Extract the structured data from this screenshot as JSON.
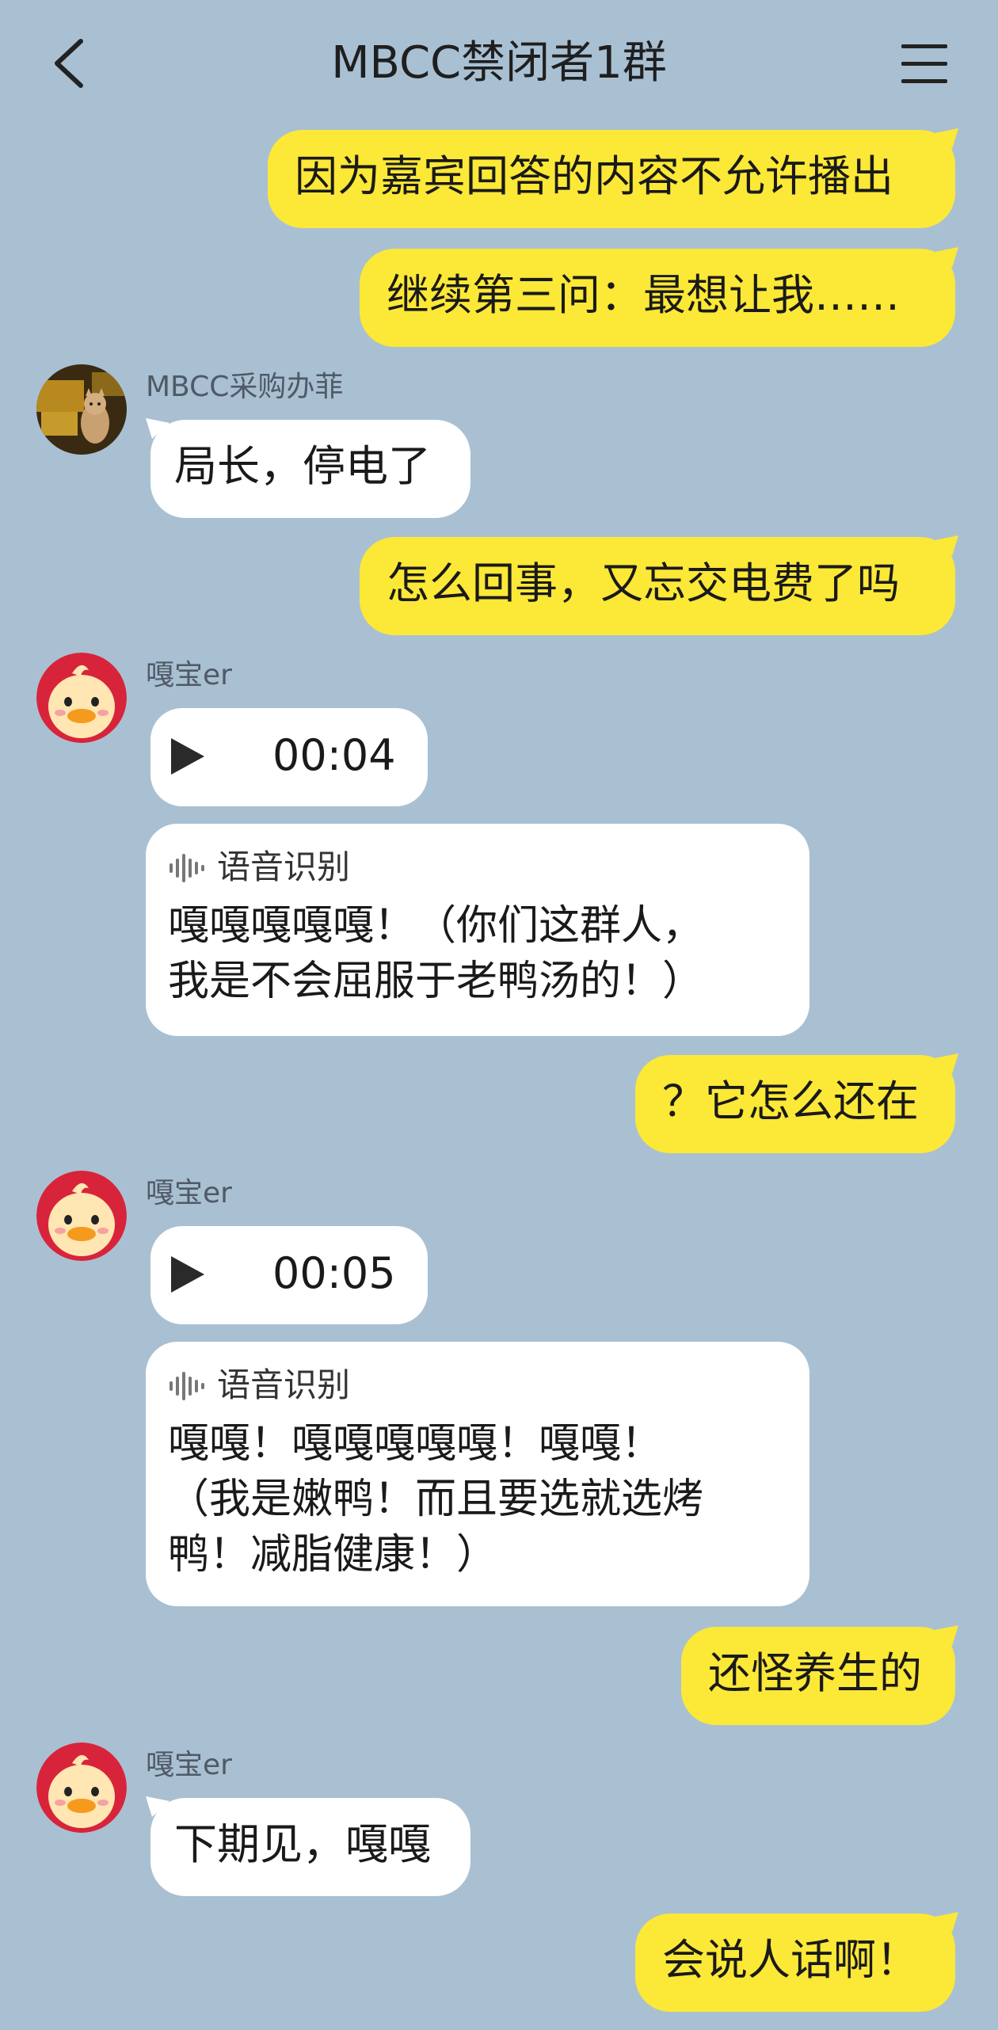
{
  "header": {
    "title": "MBCC禁闭者1群"
  },
  "messages": {
    "m1": {
      "text": "因为嘉宾回答的内容不允许播出"
    },
    "m2": {
      "text": "继续第三问：最想让我……"
    },
    "m3": {
      "sender": "MBCC采购办菲",
      "text": "局长，停电了"
    },
    "m4": {
      "text": "怎么回事，又忘交电费了吗"
    },
    "m5": {
      "sender": "嘎宝er",
      "duration": "00:04",
      "stt_label": "语音识别",
      "stt_text": "嘎嘎嘎嘎嘎！（你们这群人，\n我是不会屈服于老鸭汤的！）"
    },
    "m6": {
      "text": "？它怎么还在"
    },
    "m7": {
      "sender": "嘎宝er",
      "duration": "00:05",
      "stt_label": "语音识别",
      "stt_text": "嘎嘎！嘎嘎嘎嘎嘎！嘎嘎！\n（我是嫩鸭！而且要选就选烤\n鸭！减脂健康！）"
    },
    "m8": {
      "text": "还怪养生的"
    },
    "m9": {
      "sender": "嘎宝er",
      "text": "下期见，嘎嘎"
    },
    "m10": {
      "text": "会说人话啊！"
    }
  },
  "colors": {
    "background": "#a9c0d3",
    "outgoing_bubble": "#fce837",
    "incoming_bubble": "#ffffff"
  }
}
